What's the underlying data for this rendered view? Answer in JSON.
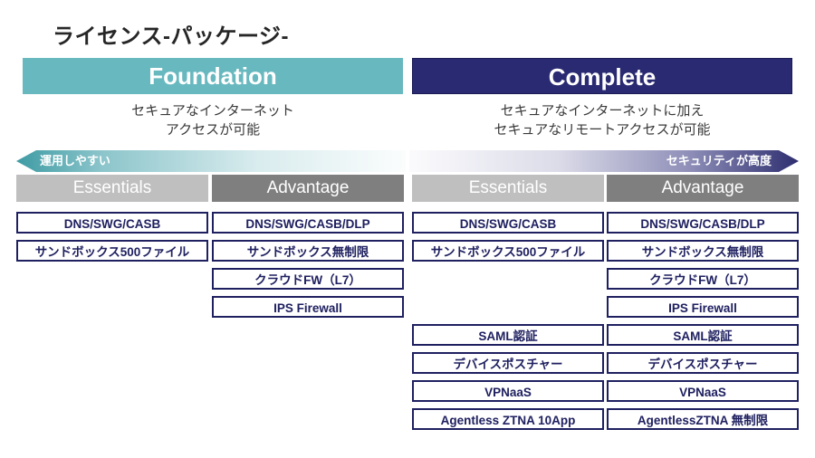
{
  "title": "ライセンス-パッケージ-",
  "colors": {
    "foundation_header_bg": "#67b8bf",
    "complete_header_bg": "#2a2a72",
    "essentials_bg": "#bfbfbf",
    "advantage_bg": "#7f7f7f",
    "box_border": "#1f2060",
    "box_text": "#1f2060"
  },
  "packages": [
    {
      "name": "Foundation",
      "caption": "セキュアなインターネット\nアクセスが可能",
      "arrow_label": "運用しやすい",
      "tiers": [
        {
          "name": "Essentials",
          "features": [
            "DNS/SWG/CASB",
            "サンドボックス500ファイル"
          ]
        },
        {
          "name": "Advantage",
          "features": [
            "DNS/SWG/CASB/DLP",
            "サンドボックス無制限",
            "クラウドFW（L7）",
            "IPS Firewall"
          ]
        }
      ]
    },
    {
      "name": "Complete",
      "caption": "セキュアなインターネットに加え\nセキュアなリモートアクセスが可能",
      "arrow_label": "セキュリティが高度",
      "tiers": [
        {
          "name": "Essentials",
          "features": [
            "DNS/SWG/CASB",
            "サンドボックス500ファイル",
            "",
            "",
            "SAML認証",
            "デバイスポスチャー",
            "VPNaaS",
            "Agentless ZTNA 10App"
          ]
        },
        {
          "name": "Advantage",
          "features": [
            "DNS/SWG/CASB/DLP",
            "サンドボックス無制限",
            "クラウドFW（L7）",
            "IPS Firewall",
            "SAML認証",
            "デバイスポスチャー",
            "VPNaaS",
            "AgentlessZTNA 無制限"
          ]
        }
      ]
    }
  ]
}
